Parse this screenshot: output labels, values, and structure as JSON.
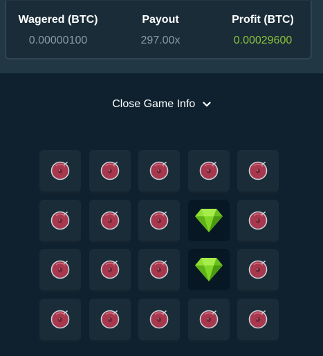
{
  "stats": {
    "wagered": {
      "label": "Wagered (BTC)",
      "value": "0.00000100"
    },
    "payout": {
      "label": "Payout",
      "value": "297.00x"
    },
    "profit": {
      "label": "Profit (BTC)",
      "value": "0.00029600"
    }
  },
  "game_info": {
    "toggle_label": "Close Game Info",
    "icon": "chevron-down-icon"
  },
  "colors": {
    "profit_value": "#8ac23b",
    "gem": "#7dd422",
    "mine": "#a8384e"
  },
  "board": {
    "rows": [
      [
        "mine",
        "mine",
        "mine",
        "mine",
        "mine"
      ],
      [
        "mine",
        "mine",
        "mine",
        "gem",
        "mine"
      ],
      [
        "mine",
        "mine",
        "mine",
        "gem",
        "mine"
      ],
      [
        "mine",
        "mine",
        "mine",
        "mine",
        "mine"
      ]
    ]
  }
}
